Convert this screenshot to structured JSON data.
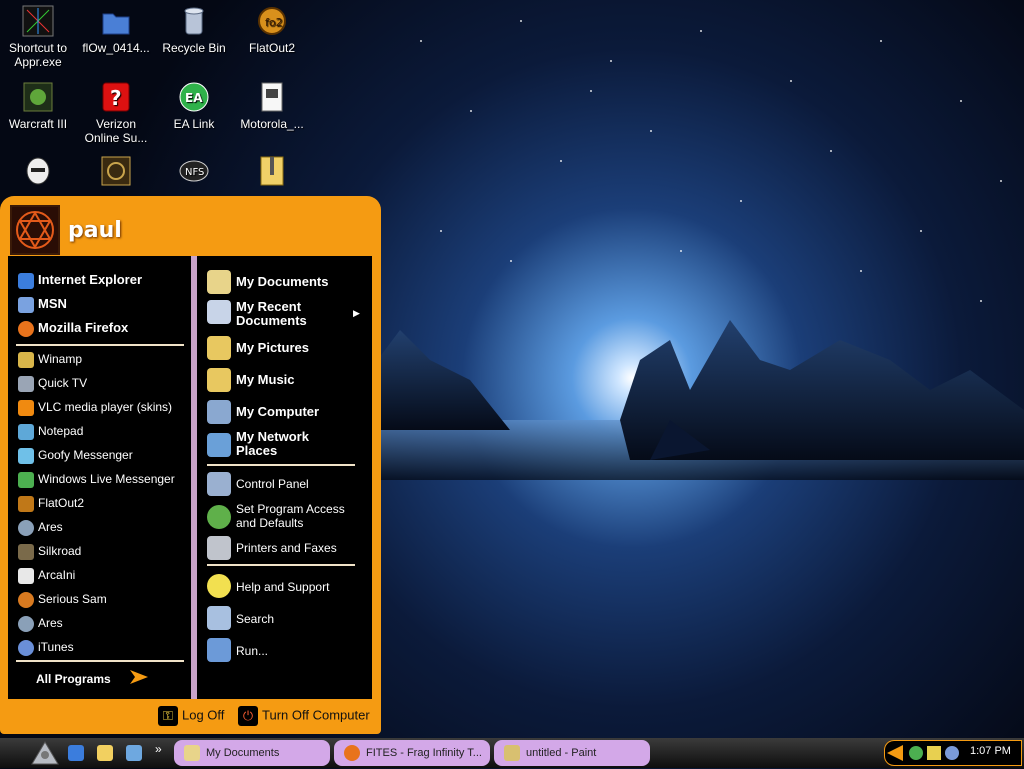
{
  "desktop": {
    "icons": [
      {
        "label": "Shortcut to\nAppr.exe"
      },
      {
        "label": "flOw_0414..."
      },
      {
        "label": "Recycle Bin"
      },
      {
        "label": "FlatOut2"
      },
      {
        "label": "Warcraft III"
      },
      {
        "label": "Verizon\nOnline Su..."
      },
      {
        "label": "EA Link"
      },
      {
        "label": "Motorola_..."
      }
    ]
  },
  "start_menu": {
    "username": "paul",
    "pinned": [
      "Internet Explorer",
      "MSN",
      "Mozilla Firefox"
    ],
    "recent": [
      "Winamp",
      "Quick TV",
      "VLC media player (skins)",
      "Notepad",
      "Goofy Messenger",
      "Windows Live Messenger",
      "FlatOut2",
      "Ares",
      "Silkroad",
      "ArcaIni",
      "Serious Sam",
      "Ares",
      "iTunes"
    ],
    "all_programs": "All Programs",
    "right": {
      "my_documents": "My Documents",
      "my_recent_documents": "My Recent Documents",
      "my_pictures": "My Pictures",
      "my_music": "My Music",
      "my_computer": "My Computer",
      "my_network_places": "My Network Places",
      "control_panel": "Control Panel",
      "set_program_access": "Set Program Access and Defaults",
      "printers_and_faxes": "Printers and Faxes",
      "help_and_support": "Help and Support",
      "search": "Search",
      "run": "Run..."
    },
    "log_off": "Log Off",
    "turn_off": "Turn Off Computer"
  },
  "taskbar": {
    "quick_launch_more": "»",
    "tasks": [
      "My Documents",
      "FITES - Frag Infinity T...",
      "untitled - Paint"
    ],
    "clock": "1:07 PM"
  },
  "colors": {
    "menu_orange": "#f59b12",
    "task_button": "#d3a8e8",
    "divider": "#c9a3c9"
  }
}
